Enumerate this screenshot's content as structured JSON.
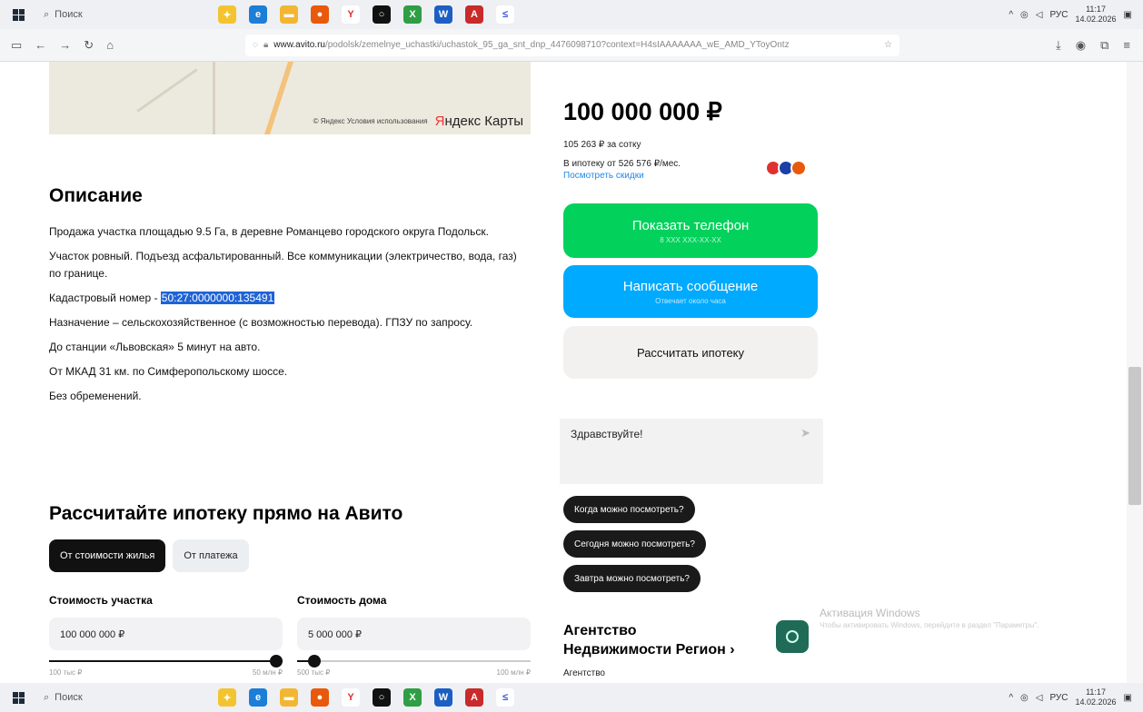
{
  "taskbar": {
    "search_label": "Поиск",
    "lang": "РУС",
    "time": "11:17",
    "date": "14.02.2026"
  },
  "browser": {
    "url_host": "www.avito.ru",
    "url_rest": "/podolsk/zemelnye_uchastki/uchastok_95_ga_snt_dnp_4476098710?context=H4sIAAAAAAA_wE_AMD_YToyOntz"
  },
  "map": {
    "credit": "© Яндекс Условия использования",
    "brand_1": "Я",
    "brand_2": "ндекс Карты"
  },
  "description": {
    "title": "Описание",
    "p1": "Продажа участка площадью 9.5 Га, в деревне Романцево городского округа Подольск.",
    "p2": "Участок ровный. Подъезд асфальтированный. Все коммуникации (электричество, вода, газ) по границе.",
    "p3_label": "Кадастровый номер - ",
    "p3_value": "50:27:0000000:135491",
    "p4": "Назначение – сельскохозяйственное (с возможностью перевода). ГПЗУ по запросу.",
    "p5": "До станции «Львовская» 5 минут на авто.",
    "p6": "От МКАД 31 км. по Симферопольскому шоссе.",
    "p7": "Без обременений."
  },
  "calculator": {
    "title": "Рассчитайте ипотеку прямо на Авито",
    "tab_active": "От стоимости жилья",
    "tab_inactive": "От платежа",
    "plot_label": "Стоимость участка",
    "plot_value": "100 000 000 ₽",
    "plot_min": "100 тыс ₽",
    "plot_max": "50 млн ₽",
    "house_label": "Стоимость дома",
    "house_value": "5 000 000 ₽",
    "house_min": "500 тыс ₽",
    "house_max": "100 млн ₽"
  },
  "sidebar": {
    "price": "100 000 000 ₽",
    "per_sotka": "105 263 ₽ за сотку",
    "mortgage": "В ипотеку от 526 576 ₽/мес.",
    "discounts_link": "Посмотреть скидки",
    "phone_button": "Показать телефон",
    "phone_sub": "8 XXX XXX-XX-XX",
    "message_button": "Написать сообщение",
    "message_sub": "Отвечает около часа",
    "mortgage_button": "Рассчитать ипотеку",
    "chat_text": "Здравствуйте!",
    "chip1": "Когда можно посмотреть?",
    "chip2": "Сегодня можно посмотреть?",
    "chip3": "Завтра можно посмотреть?",
    "agency_line1": "Агентство",
    "agency_line2": "Недвижимости Регион ›",
    "agency_sub": "Агентство"
  },
  "watermark": {
    "title": "Активация Windows",
    "text": "Чтобы активировать Windows, перейдите в раздел \"Параметры\"."
  },
  "colors": {
    "green": "#02d15c",
    "blue": "#00aaff",
    "selection": "#1e63d6"
  }
}
